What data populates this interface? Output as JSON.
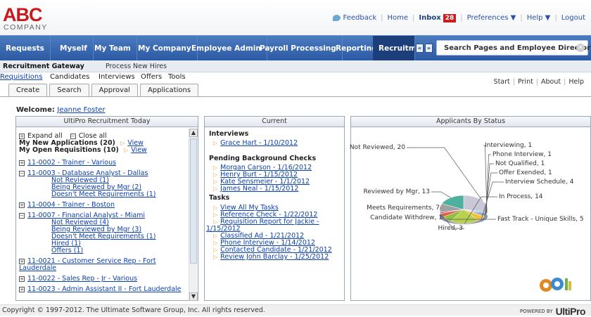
{
  "header": {
    "logo_main": "ABC",
    "logo_sub": "COMPANY",
    "links": {
      "feedback": "Feedback",
      "home": "Home",
      "inbox": "Inbox",
      "inbox_count": "28",
      "preferences": "Preferences ▼",
      "help": "Help ▼",
      "logout": "Logout"
    }
  },
  "nav": {
    "items": [
      "Requests",
      "Myself",
      "My Team",
      "My Company",
      "Employee Admin",
      "Payroll Processing",
      "Reporting",
      "Recruitme"
    ],
    "search_placeholder": "Search Pages and Employee Directory"
  },
  "subnav": {
    "items": [
      "Recruitment Gateway",
      "Process New Hires"
    ]
  },
  "tools": {
    "items": [
      "Requisitions",
      "Candidates",
      "Interviews",
      "Offers",
      "Tools"
    ]
  },
  "tabs": [
    "Create",
    "Search",
    "Approval",
    "Applications"
  ],
  "right_links": [
    "Start",
    "Print",
    "About",
    "Help"
  ],
  "welcome": {
    "label": "Welcome:",
    "user": "Jeanne Foster"
  },
  "left_panel": {
    "title": "UltiPro Recruitment Today",
    "expand_all": "Expand all",
    "close_all": "Close all",
    "my_apps": "My New Applications (20)",
    "my_reqs": "My Open Requisitions (10)",
    "view": "View",
    "reqs": [
      {
        "label": "11-0002 - Trainer - Various"
      },
      {
        "label": "11-0003 - Database Analyst - Dallas",
        "subs": [
          "Not Reviewed (1)",
          "Being Reviewed by Mgr (2)",
          "Doesn't Meet Requirements (1)"
        ]
      },
      {
        "label": "11-0004 - Trainer - Boston"
      },
      {
        "label": "11-0007 - Financial Analyst - Miami",
        "subs": [
          "Not Reviewed (4)",
          "Being Reviewed by Mgr (3)",
          "Doesn't Meet Requirements (1)",
          "Hired (1)",
          "Offers (1)"
        ]
      },
      {
        "label": "11-0021 - Customer Service Rep - Fort",
        "label2": "Lauderdale"
      },
      {
        "label": "11-0022 - Sales Rep - Jr - Various"
      },
      {
        "label": "11-0023 - Admin Assistant II - Fort Lauderdale"
      }
    ]
  },
  "mid_panel": {
    "title": "Current",
    "interviews_head": "Interviews",
    "interviews": [
      "Grace Hart - 1/10/2012"
    ],
    "checks_head": "Pending Background Checks",
    "checks": [
      "Morgan Carson - 1/16/2012",
      "Henry Burt - 1/15/2012",
      "Kate Sensmeier - 1/1/2012",
      "James Neal - 1/15/2012"
    ],
    "tasks_head": "Tasks",
    "tasks": [
      "View All My Tasks",
      "Reference Check - 1/22/2012",
      "Requisition Report for Jackie -",
      "1/15/2012",
      "Classified Ad - 1/21/2012",
      "Phone Interview - 1/14/2012",
      "Contacted Candidate - 1/21/2012",
      "Review John Barclay - 1/25/2012"
    ]
  },
  "chart_data": {
    "type": "pie",
    "title": "Applicants By Status",
    "categories": [
      "Not Reviewed",
      "Interviewing",
      "Phone Interview",
      "Not Qualified",
      "Offer Exended",
      "Interview Schedule",
      "In Process",
      "Fast Track - Unique Skills",
      "Hired",
      "Candidate Withdrew",
      "Meets Requirements",
      "Reviewed by Mgr"
    ],
    "values": [
      20,
      1,
      1,
      1,
      1,
      4,
      14,
      5,
      3,
      1,
      7,
      13
    ],
    "colors": [
      "#c8c8d8",
      "#7ab2e0",
      "#6090c8",
      "#3a6eb0",
      "#e0a030",
      "#f0c040",
      "#b8d050",
      "#90c040",
      "#e06040",
      "#c04880",
      "#a0a0a0",
      "#50b0a0"
    ]
  },
  "footer": {
    "copyright": "Copyright © 1997-2012. The Ultimate Software Group, Inc. All rights reserved.",
    "powered": "POWERED BY",
    "brand": "UltiPro"
  }
}
